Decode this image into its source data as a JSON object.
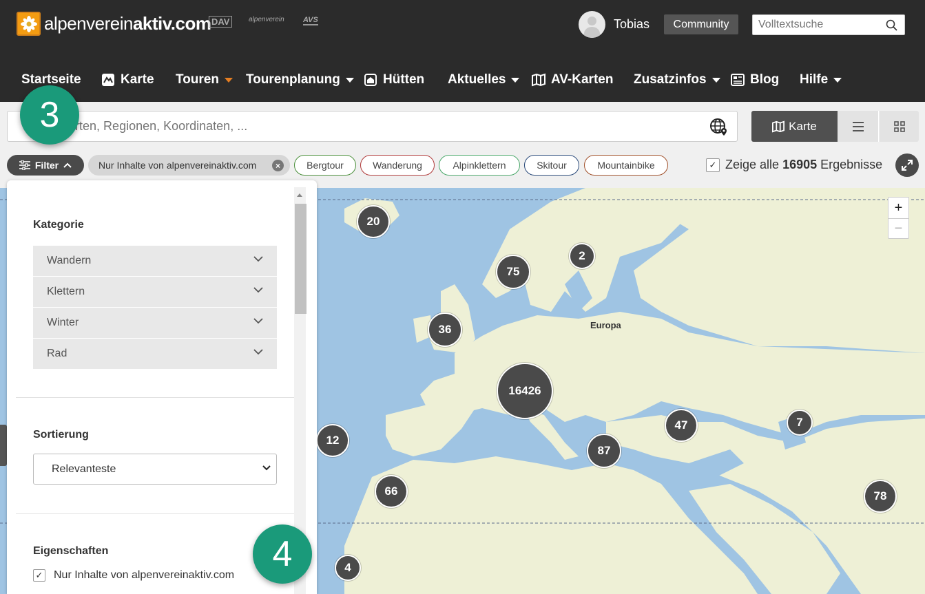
{
  "header": {
    "logo_text_light": "alpenverein",
    "logo_text_bold": "aktiv.com",
    "partners": [
      "DAV",
      "alpenverein",
      "AVS"
    ],
    "user_name": "Tobias",
    "community_label": "Community",
    "fulltext_placeholder": "Volltextsuche"
  },
  "nav": [
    {
      "label": "Startseite"
    },
    {
      "label": "Karte"
    },
    {
      "label": "Touren"
    },
    {
      "label": "Tourenplanung"
    },
    {
      "label": "Hütten"
    },
    {
      "label": "Aktuelles"
    },
    {
      "label": "AV-Karten"
    },
    {
      "label": "Zusatzinfos"
    },
    {
      "label": "Blog"
    },
    {
      "label": "Hilfe"
    }
  ],
  "search": {
    "placeholder": "nach Orten, Regionen, Koordinaten, ..."
  },
  "views": {
    "karte_label": "Karte"
  },
  "filters": {
    "button_label": "Filter",
    "active_chip": "Nur Inhalte von alpenvereinaktiv.com",
    "chips": [
      {
        "label": "Bergtour",
        "color": "#4a8f3a"
      },
      {
        "label": "Wanderung",
        "color": "#b03a3a"
      },
      {
        "label": "Alpinklettern",
        "color": "#4aa86a"
      },
      {
        "label": "Skitour",
        "color": "#2a4a7a"
      },
      {
        "label": "Mountainbike",
        "color": "#a0502a"
      }
    ],
    "show_all_prefix": "Zeige alle",
    "show_all_count": "16905",
    "show_all_suffix": "Ergebnisse"
  },
  "map": {
    "label_europe": "Europa",
    "zoom_in": "+",
    "zoom_out": "−",
    "clusters": [
      "20",
      "2",
      "75",
      "36",
      "16426",
      "12",
      "47",
      "7",
      "87",
      "66",
      "78",
      "4"
    ]
  },
  "panel": {
    "kategorie_title": "Kategorie",
    "categories": [
      "Wandern",
      "Klettern",
      "Winter",
      "Rad"
    ],
    "sortierung_title": "Sortierung",
    "sort_value": "Relevanteste",
    "eigenschaften_title": "Eigenschaften",
    "property_1": "Nur Inhalte von alpenvereinaktiv.com"
  },
  "steps": [
    "3",
    "4"
  ],
  "colors": {
    "header_bg": "#2b2b2b",
    "accent_orange": "#e67e22",
    "step_green": "#1a9a7a",
    "water": "#9fc4e3",
    "land": "#eef0d6"
  }
}
